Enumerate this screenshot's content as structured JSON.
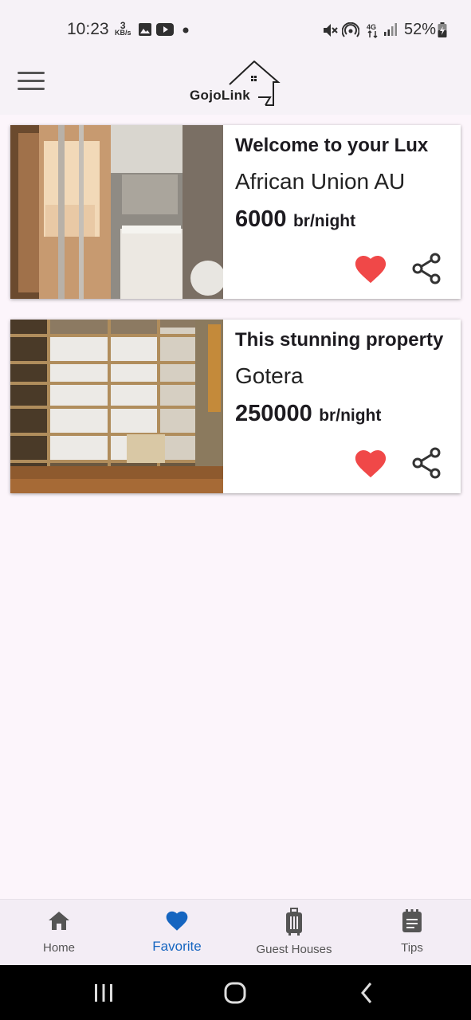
{
  "status_bar": {
    "time": "10:23",
    "net_speed_value": "3",
    "net_speed_unit": "KB/s",
    "battery": "52%",
    "icons": [
      "image-icon",
      "youtube-icon",
      "dot-icon",
      "mute-icon",
      "hotspot-icon",
      "4g-icon",
      "signal-icon",
      "battery-icon"
    ]
  },
  "app_bar": {
    "logo_text": "GojoLink",
    "menu_icon": "hamburger-menu-icon"
  },
  "listings": [
    {
      "title": "Welcome to your Lux",
      "location": "African Union AU",
      "price": "6000",
      "unit": "br/night",
      "favorited": true
    },
    {
      "title": "This stunning property",
      "location": "Gotera",
      "price": "250000",
      "unit": "br/night",
      "favorited": true
    }
  ],
  "bottom_nav": {
    "items": [
      {
        "label": "Home",
        "icon": "home-icon",
        "active": false
      },
      {
        "label": "Favorite",
        "icon": "heart-icon",
        "active": true
      },
      {
        "label": "Guest Houses",
        "icon": "luggage-icon",
        "active": false
      },
      {
        "label": "Tips",
        "icon": "clipboard-icon",
        "active": false
      }
    ]
  },
  "colors": {
    "accent": "#1565c0",
    "favorite": "#f04848",
    "background": "#fcf5fb"
  }
}
